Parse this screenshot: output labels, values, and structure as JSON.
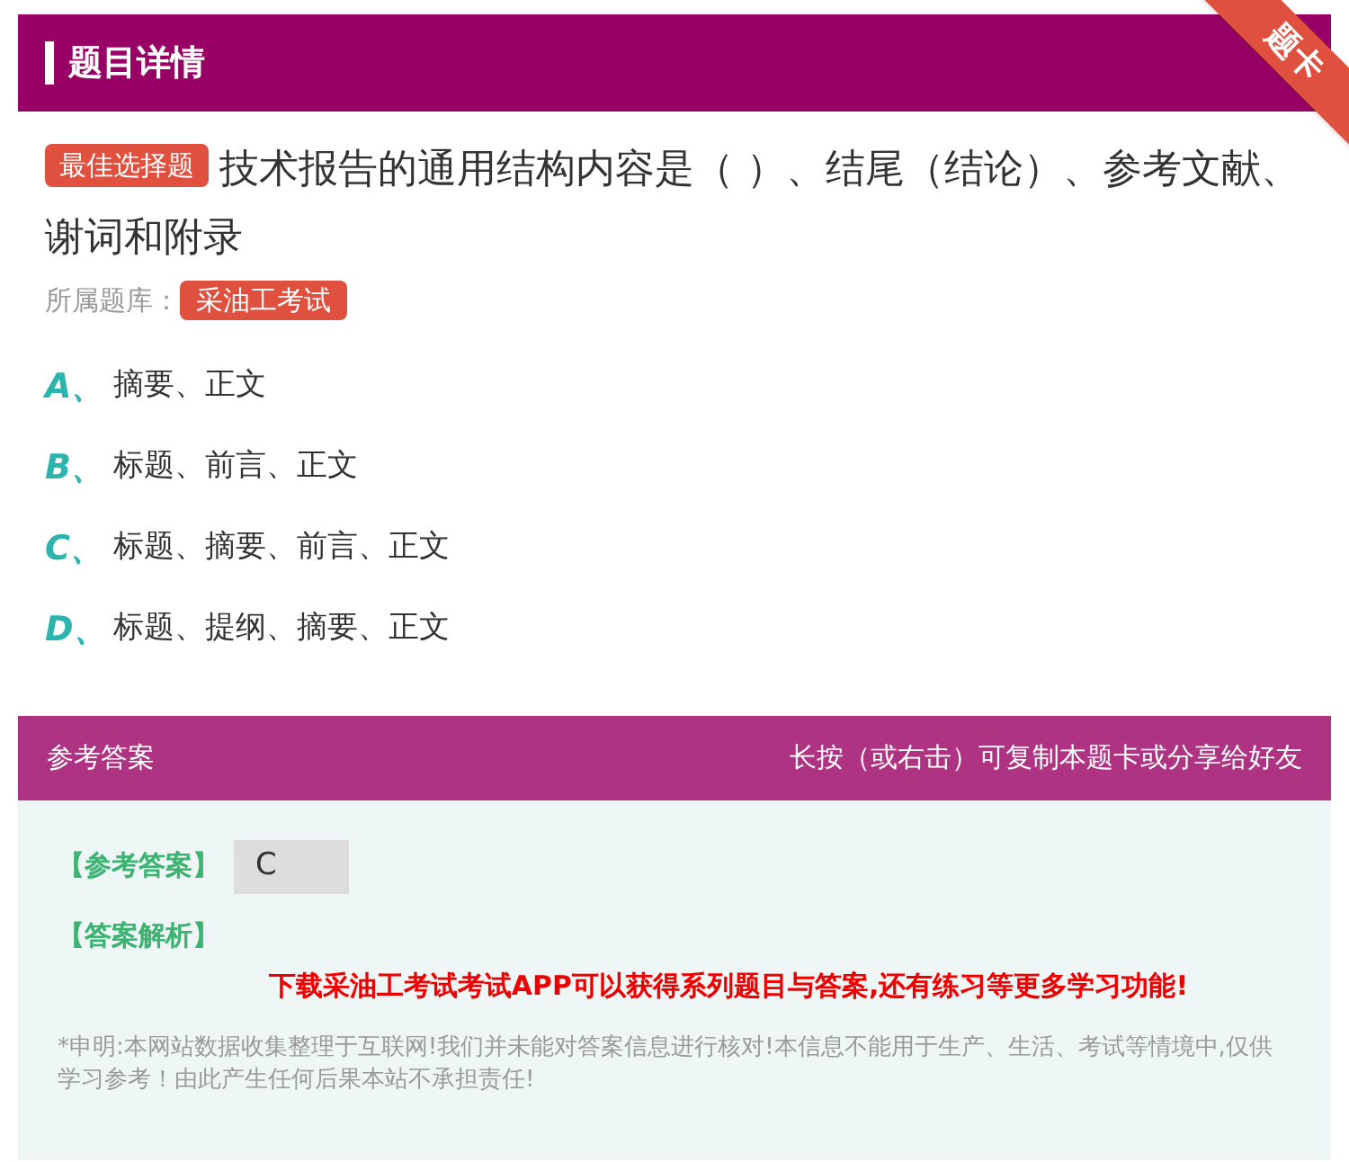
{
  "header": {
    "title": "题目详情",
    "ribbon": "题卡"
  },
  "question": {
    "type_badge": "最佳选择题",
    "text": "技术报告的通用结构内容是（ ）、结尾（结论）、参考文献、谢词和附录",
    "bank_label": "所属题库：",
    "bank": "采油工考试"
  },
  "options": [
    {
      "letter": "A",
      "separator": "、",
      "text": "摘要、正文"
    },
    {
      "letter": "B",
      "separator": "、",
      "text": "标题、前言、正文"
    },
    {
      "letter": "C",
      "separator": "、",
      "text": "标题、摘要、前言、正文"
    },
    {
      "letter": "D",
      "separator": "、",
      "text": "标题、提纲、摘要、正文"
    }
  ],
  "answer_bar": {
    "title": "参考答案",
    "hint": "长按（或右击）可复制本题卡或分享给好友"
  },
  "answer": {
    "label": "【参考答案】",
    "value": "C",
    "analysis_label": "【答案解析】",
    "promo": "下载采油工考试考试APP可以获得系列题目与答案,还有练习等更多学习功能!",
    "disclaimer": "*申明:本网站数据收集整理于互联网!我们并未能对答案信息进行核对!本信息不能用于生产、生活、考试等情境中,仅供学习参考！由此产生任何后果本站不承担责任!"
  }
}
